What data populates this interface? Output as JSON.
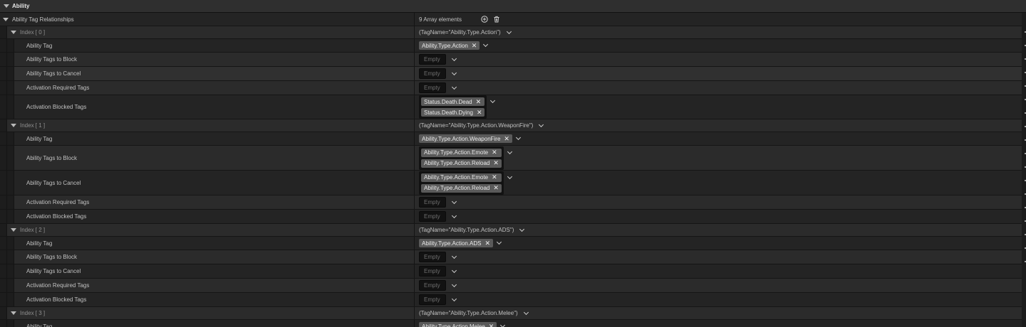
{
  "category": {
    "title": "Ability"
  },
  "array_property": {
    "label": "Ability Tag Relationships",
    "summary": "9 Array elements"
  },
  "common": {
    "empty": "Empty"
  },
  "indices": [
    {
      "label": "Index [ 0 ]",
      "summary": "(TagName=\"Ability.Type.Action\")",
      "fields": [
        {
          "label": "Ability Tag",
          "tags": [
            "Ability.Type.Action"
          ]
        },
        {
          "label": "Ability Tags to Block",
          "tags": []
        },
        {
          "label": "Ability Tags to Cancel",
          "tags": []
        },
        {
          "label": "Activation Required Tags",
          "tags": []
        },
        {
          "label": "Activation Blocked Tags",
          "tags": [
            "Status.Death.Dead",
            "Status.Death.Dying"
          ]
        }
      ]
    },
    {
      "label": "Index [ 1 ]",
      "summary": "(TagName=\"Ability.Type.Action.WeaponFire\")",
      "fields": [
        {
          "label": "Ability Tag",
          "tags": [
            "Ability.Type.Action.WeaponFire"
          ]
        },
        {
          "label": "Ability Tags to Block",
          "tags": [
            "Ability.Type.Action.Emote",
            "Ability.Type.Action.Reload"
          ]
        },
        {
          "label": "Ability Tags to Cancel",
          "tags": [
            "Ability.Type.Action.Emote",
            "Ability.Type.Action.Reload"
          ]
        },
        {
          "label": "Activation Required Tags",
          "tags": []
        },
        {
          "label": "Activation Blocked Tags",
          "tags": []
        }
      ]
    },
    {
      "label": "Index [ 2 ]",
      "summary": "(TagName=\"Ability.Type.Action.ADS\")",
      "fields": [
        {
          "label": "Ability Tag",
          "tags": [
            "Ability.Type.Action.ADS"
          ]
        },
        {
          "label": "Ability Tags to Block",
          "tags": []
        },
        {
          "label": "Ability Tags to Cancel",
          "tags": []
        },
        {
          "label": "Activation Required Tags",
          "tags": []
        },
        {
          "label": "Activation Blocked Tags",
          "tags": []
        }
      ]
    },
    {
      "label": "Index [ 3 ]",
      "summary": "(TagName=\"Ability.Type.Action.Melee\")",
      "fields": [
        {
          "label": "Ability Tag",
          "tags": [
            "Ability.Type.Action.Melee"
          ]
        }
      ]
    }
  ],
  "icons": {
    "collapse": "triangle-down-icon",
    "add": "add-circle-icon",
    "delete": "trash-icon",
    "remove_tag": "close-icon",
    "dropdown": "chevron-down-icon"
  }
}
